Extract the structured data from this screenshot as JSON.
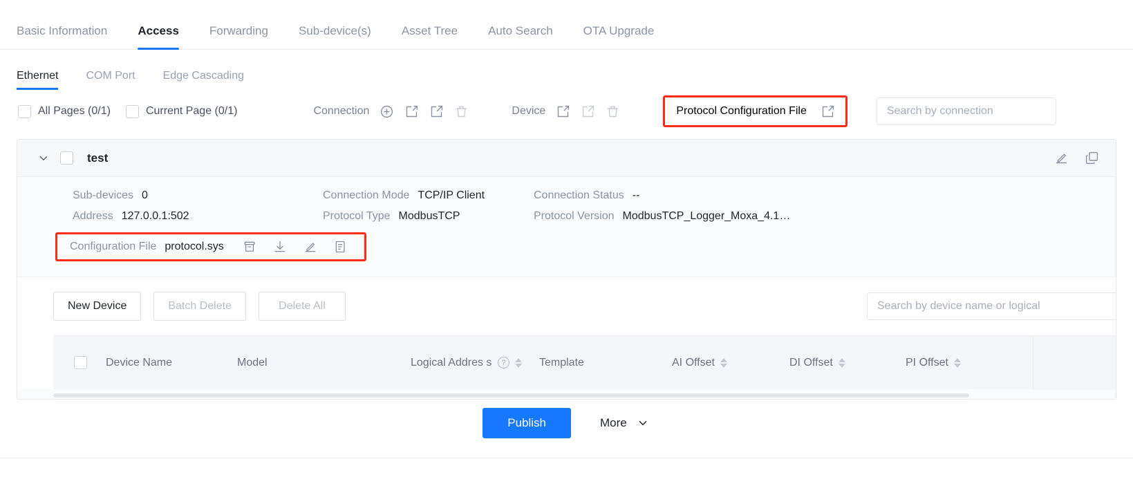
{
  "top_tabs": [
    {
      "label": "Basic Information",
      "active": false
    },
    {
      "label": "Access",
      "active": true
    },
    {
      "label": "Forwarding",
      "active": false
    },
    {
      "label": "Sub-device(s)",
      "active": false
    },
    {
      "label": "Asset Tree",
      "active": false
    },
    {
      "label": "Auto Search",
      "active": false
    },
    {
      "label": "OTA Upgrade",
      "active": false
    }
  ],
  "sub_tabs": [
    {
      "label": "Ethernet",
      "active": true
    },
    {
      "label": "COM Port",
      "active": false
    },
    {
      "label": "Edge Cascading",
      "active": false
    }
  ],
  "toolbar": {
    "all_pages_label": "All Pages (0/1)",
    "current_page_label": "Current Page (0/1)",
    "connection_label": "Connection",
    "device_label": "Device",
    "protocol_config_file_label": "Protocol  Configuration  File",
    "search_placeholder": "Search by connection",
    "connection_icons": [
      "add-circle-icon",
      "import-icon",
      "export-icon",
      "trash-icon"
    ],
    "device_icons": [
      "import-icon",
      "export-icon",
      "trash-icon"
    ],
    "protocol_icons": [
      "import-icon"
    ]
  },
  "card": {
    "title": "test",
    "expanded": true,
    "details": [
      {
        "key": "Sub-devices",
        "value": "0"
      },
      {
        "key": "Connection Mode",
        "value": "TCP/IP Client"
      },
      {
        "key": "Connection Status",
        "value": "--"
      },
      {
        "key": "Address",
        "value": "127.0.0.1:502"
      },
      {
        "key": "Protocol Type",
        "value": "ModbusTCP"
      },
      {
        "key": "Protocol Version",
        "value": "ModbusTCP_Logger_Moxa_4.1…"
      }
    ],
    "config_file": {
      "label": "Configuration File",
      "value": "protocol.sys",
      "icons": [
        "archive-icon",
        "download-icon",
        "edit-pen-icon",
        "form-edit-icon"
      ]
    },
    "head_icons": [
      "edit-pen-icon",
      "copy-icon"
    ]
  },
  "device_toolbar": {
    "new_device": "New Device",
    "batch_delete": "Batch Delete",
    "delete_all": "Delete All",
    "search_placeholder": "Search by device name or logical"
  },
  "table": {
    "columns": [
      {
        "label": "Device Name",
        "sortable": false,
        "help": false
      },
      {
        "label": "Model",
        "sortable": false,
        "help": false
      },
      {
        "label": "Logical Addres s",
        "sortable": true,
        "help": true
      },
      {
        "label": "Template",
        "sortable": false,
        "help": false
      },
      {
        "label": "AI Offset",
        "sortable": true,
        "help": false
      },
      {
        "label": "DI Offset",
        "sortable": true,
        "help": false
      },
      {
        "label": "PI Offset",
        "sortable": true,
        "help": false
      }
    ],
    "rows": []
  },
  "footer": {
    "publish": "Publish",
    "more": "More"
  },
  "colors": {
    "accent": "#1677ff",
    "highlight_box": "#ff2b17",
    "text_primary": "#1f2329",
    "text_muted": "#8c94a3"
  }
}
